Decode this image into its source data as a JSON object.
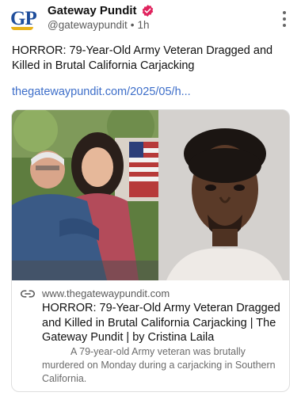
{
  "account": {
    "avatar_text": "GP",
    "display_name": "Gateway Pundit",
    "handle": "@gatewaypundit",
    "separator": "•",
    "time": "1h"
  },
  "post": {
    "text": "HORROR: 79-Year-Old Army Veteran Dragged and Killed in Brutal California Carjacking",
    "link": "thegatewaypundit.com/2025/05/h..."
  },
  "card": {
    "domain": "www.thegatewaypundit.com",
    "title": "HORROR: 79-Year-Old Army Veteran Dragged and Killed in Brutal California Carjacking | The Gateway Pundit | by Cristina Laila",
    "description": "A 79-year-old Army veteran was brutally murdered on Monday during a carjacking in Southern California."
  },
  "icons": [
    "verified-badge-icon",
    "more-options-icon",
    "link-icon"
  ],
  "colors": {
    "link": "#3d6ec9",
    "verified": "#e0245e",
    "brand_blue": "#1f4e9c",
    "brand_gold": "#e8b21a"
  }
}
